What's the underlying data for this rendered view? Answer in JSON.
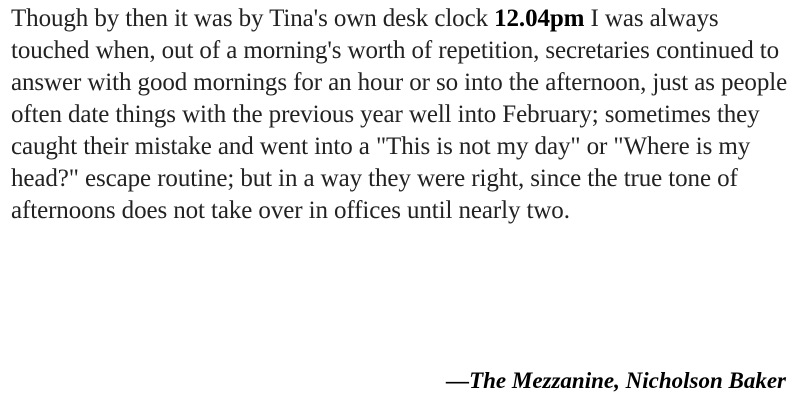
{
  "quote": {
    "before_time": "Though by then it was by Tina's own desk clock ",
    "time": "12.04pm",
    "after_time": " I was always touched when, out of a morning's worth of repetition, secretaries continued to answer with good mornings for an hour or so into the afternoon, just as people often date things with the previous year well into February; sometimes they caught their mistake and went into a \"This is not my day\" or \"Where is my head?\" escape routine; but in a way they were right, since the true tone of afternoons does not take over in offices until nearly two."
  },
  "attribution": {
    "dash": "—",
    "title": "The Mezzanine",
    "separator": ", ",
    "author": "Nicholson Baker"
  }
}
